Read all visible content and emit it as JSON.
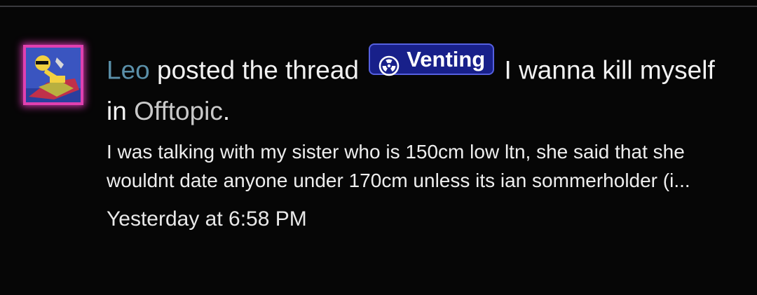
{
  "activity": {
    "username": "Leo",
    "action_text": " posted the thread ",
    "prefix": {
      "label": "Venting",
      "icon": "radiation-icon",
      "color": "#18208a"
    },
    "thread_title": " I wanna kill myself",
    "in_text": " in ",
    "forum": "Offtopic",
    "period": ".",
    "snippet": "I was talking with my sister who is 150cm low ltn, she said that she wouldnt date anyone under 170cm unless its ian sommerholder (i...",
    "timestamp": "Yesterday at 6:58 PM"
  },
  "colors": {
    "background": "#060606",
    "username": "#5a8fa8",
    "avatar_glow": "#e040b0"
  }
}
